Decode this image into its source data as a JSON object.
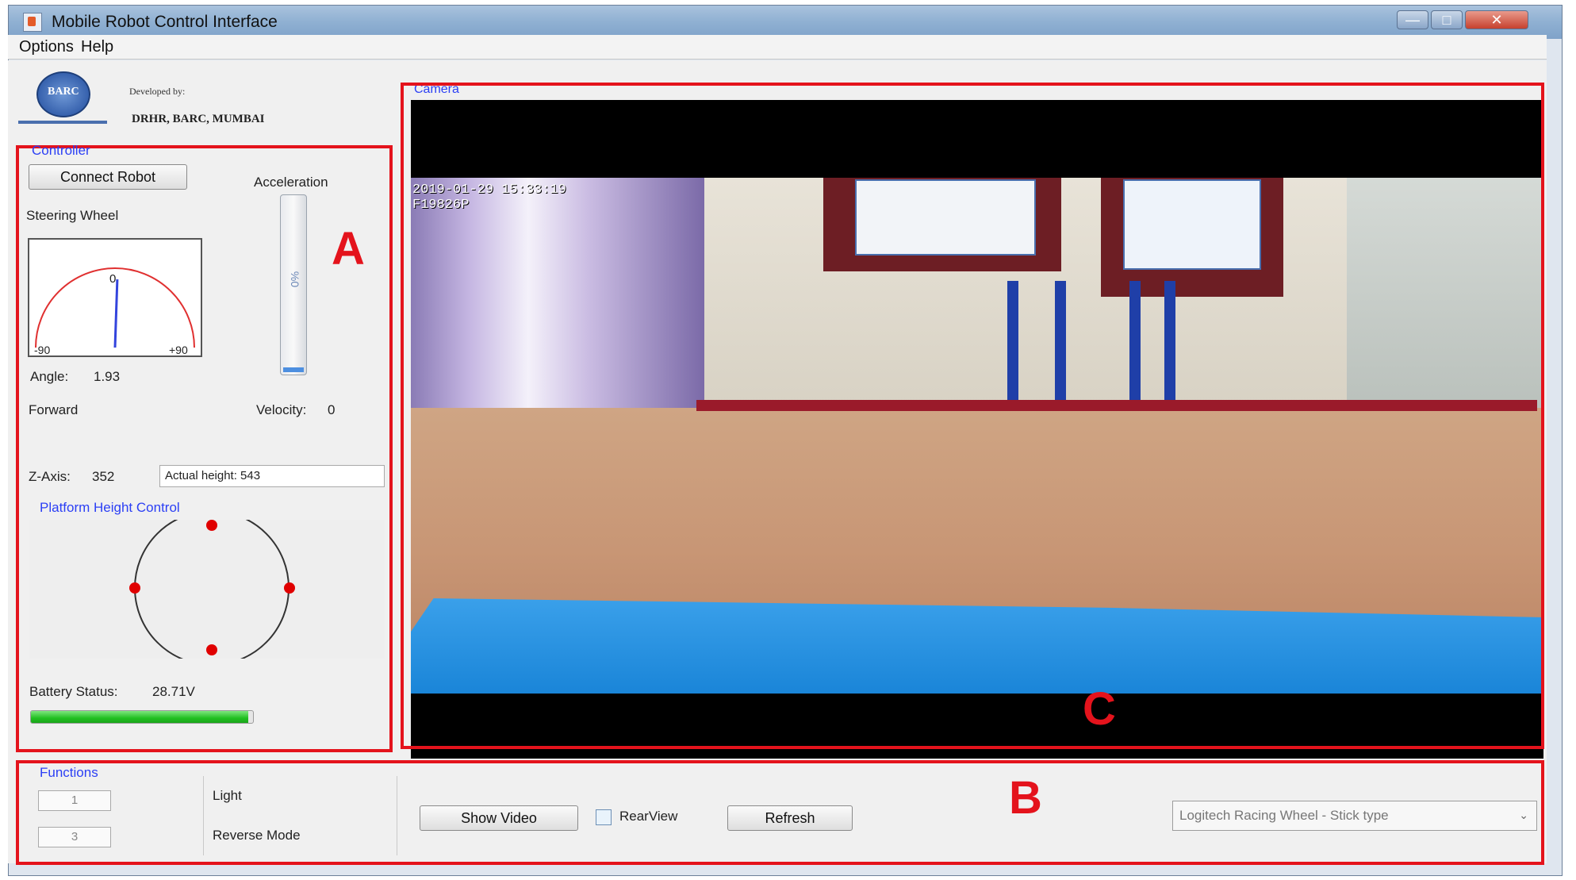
{
  "window": {
    "title": "Mobile Robot Control Interface",
    "controls": {
      "minimize": "—",
      "maximize": "□",
      "close": "✕"
    }
  },
  "menu": [
    "Options",
    "Help"
  ],
  "header": {
    "logo_text": "BARC",
    "developed_by_label": "Developed by:",
    "developer": "DRHR, BARC, MUMBAI"
  },
  "controller": {
    "group_label": "Controller",
    "connect_label": "Connect Robot",
    "steering_label": "Steering Wheel",
    "gauge": {
      "center_label": "0",
      "min_label": "-90",
      "max_label": "+90",
      "angle_value": 1.93
    },
    "acceleration_label": "Acceleration",
    "acceleration_text": "%0",
    "acceleration_level": 0.0,
    "angle_label": "Angle:",
    "angle_text": "1.93",
    "direction": "Forward",
    "velocity_label": "Velocity:",
    "velocity_value": "0",
    "zaxis_label": "Z-Axis:",
    "zaxis_value": "352",
    "actual_height": "Actual height: 543",
    "platform_label": "Platform Height Control",
    "battery_label": "Battery Status:",
    "battery_value": "28.71V",
    "battery_level": 0.98
  },
  "camera": {
    "label": "Camera",
    "timestamp": "2019-01-29 15:33:19",
    "frame_id": "F19826P"
  },
  "functions": {
    "label": "Functions",
    "items": [
      {
        "key": "1",
        "label": "Light"
      },
      {
        "key": "3",
        "label": "Reverse Mode"
      }
    ],
    "show_video_label": "Show Video",
    "rearview_label": "RearView",
    "rearview_checked": false,
    "refresh_label": "Refresh",
    "device_selected": "Logitech Racing Wheel - Stick type"
  },
  "markers": {
    "a": "A",
    "b": "B",
    "c": "C"
  },
  "colors": {
    "annotation_red": "#e4131c",
    "group_label_blue": "#2b3ff5",
    "battery_green": "#21c021"
  }
}
